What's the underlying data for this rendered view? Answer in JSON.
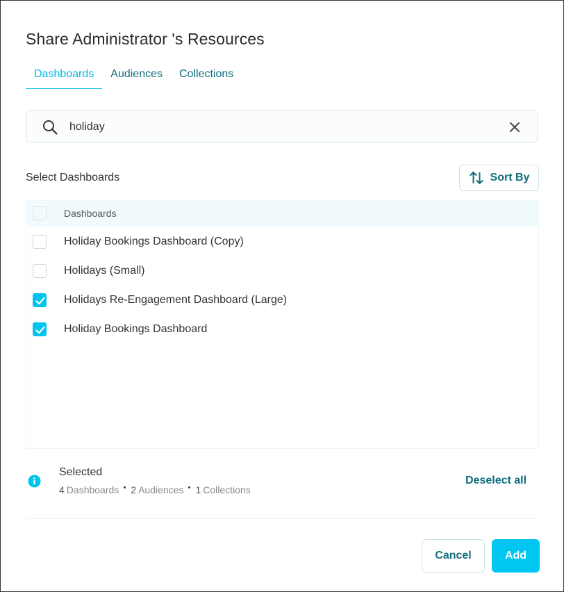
{
  "dialog": {
    "title": "Share Administrator 's Resources"
  },
  "tabs": [
    {
      "label": "Dashboards",
      "active": true
    },
    {
      "label": "Audiences",
      "active": false
    },
    {
      "label": "Collections",
      "active": false
    }
  ],
  "search": {
    "value": "holiday",
    "icon": "search-icon",
    "clear_icon": "close-icon"
  },
  "select_label": "Select Dashboards",
  "sort": {
    "label": "Sort By",
    "icon": "sort-arrows-icon"
  },
  "list": {
    "header": "Dashboards",
    "header_checked": false,
    "items": [
      {
        "label": "Holiday Bookings Dashboard (Copy)",
        "checked": false
      },
      {
        "label": "Holidays (Small)",
        "checked": false
      },
      {
        "label": "Holidays Re-Engagement Dashboard (Large)",
        "checked": true
      },
      {
        "label": "Holiday Bookings Dashboard",
        "checked": true
      }
    ]
  },
  "selected": {
    "title": "Selected",
    "icon": "info-icon",
    "counts": [
      {
        "count": "4",
        "label": "Dashboards"
      },
      {
        "count": "2",
        "label": "Audiences"
      },
      {
        "count": "1",
        "label": "Collections"
      }
    ],
    "deselect_label": "Deselect all"
  },
  "footer": {
    "cancel_label": "Cancel",
    "add_label": "Add"
  },
  "colors": {
    "accent": "#00c6f2",
    "active_tab": "#00b8ea",
    "link": "#0f6e7e",
    "header_bg": "#f1fbfd"
  }
}
